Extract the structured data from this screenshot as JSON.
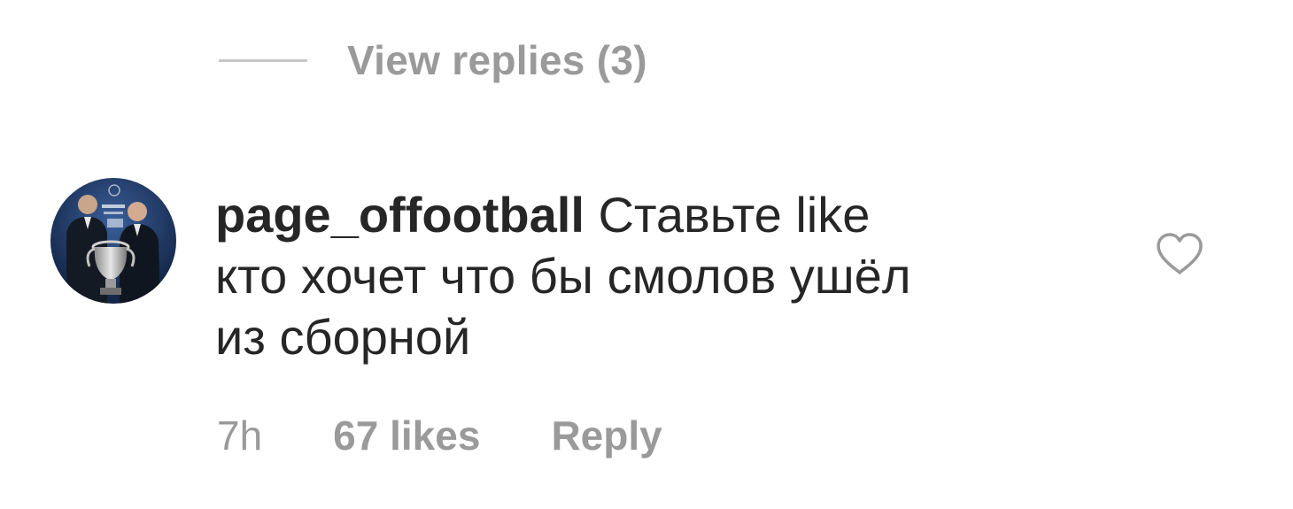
{
  "replies": {
    "label": "View replies (3)"
  },
  "comment": {
    "username": "page_offootball",
    "lines": [
      "Ставьте like",
      "кто хочет что бы смолов ушёл",
      "из сборной"
    ],
    "time": "7h",
    "likes": "67 likes",
    "reply_label": "Reply"
  },
  "icons": {
    "like": "heart-outline-icon"
  },
  "colors": {
    "text": "#262626",
    "muted": "#9a9a9a",
    "divider": "#c7c7c7",
    "avatar_background": "#1f3a6b"
  }
}
